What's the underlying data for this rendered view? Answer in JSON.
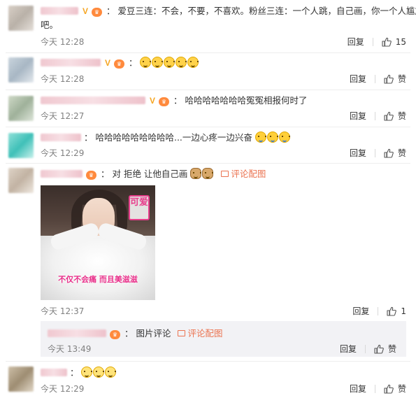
{
  "icons": {
    "like": "thumbs-up-icon",
    "picture": "picture-icon",
    "level_badge": "level-badge-icon",
    "verified": "verified-v-icon"
  },
  "colors": {
    "link": "#eb7350",
    "meta": "#808080",
    "level_badge": "#ff8a3d",
    "verified": "#f5a623"
  },
  "comments": [
    {
      "verified": "V",
      "text_line1": "爱豆三连：不会，不要，不喜欢。粉丝三连：一个人跳，自己画，你一个人尴尬",
      "text_line2": "吧。",
      "time": "今天 12:28",
      "reply": "回复",
      "likes": "15"
    },
    {
      "verified": "V",
      "text": "",
      "time": "今天 12:28",
      "reply": "回复",
      "likes": "赞"
    },
    {
      "verified": "V",
      "text": "哈哈哈哈哈哈哈冤冤相报何时了",
      "time": "今天 12:27",
      "reply": "回复",
      "likes": "赞"
    },
    {
      "text": "哈哈哈哈哈哈哈哈哈...一边心疼一边兴奋",
      "time": "今天 12:29",
      "reply": "回复",
      "likes": "赞"
    },
    {
      "text": "对 拒绝 让他自己画",
      "pic_link": "评论配图",
      "image": {
        "stamp": "可爱",
        "caption": "不仅不会痛 而且美滋滋"
      },
      "time": "今天 12:37",
      "reply": "回复",
      "likes": "1",
      "sub_reply": {
        "text": "图片评论",
        "pic_link": "评论配图",
        "time": "今天 13:49",
        "reply": "回复",
        "likes": "赞"
      }
    },
    {
      "text": "",
      "time": "今天 12:29",
      "reply": "回复",
      "likes": "赞"
    }
  ]
}
